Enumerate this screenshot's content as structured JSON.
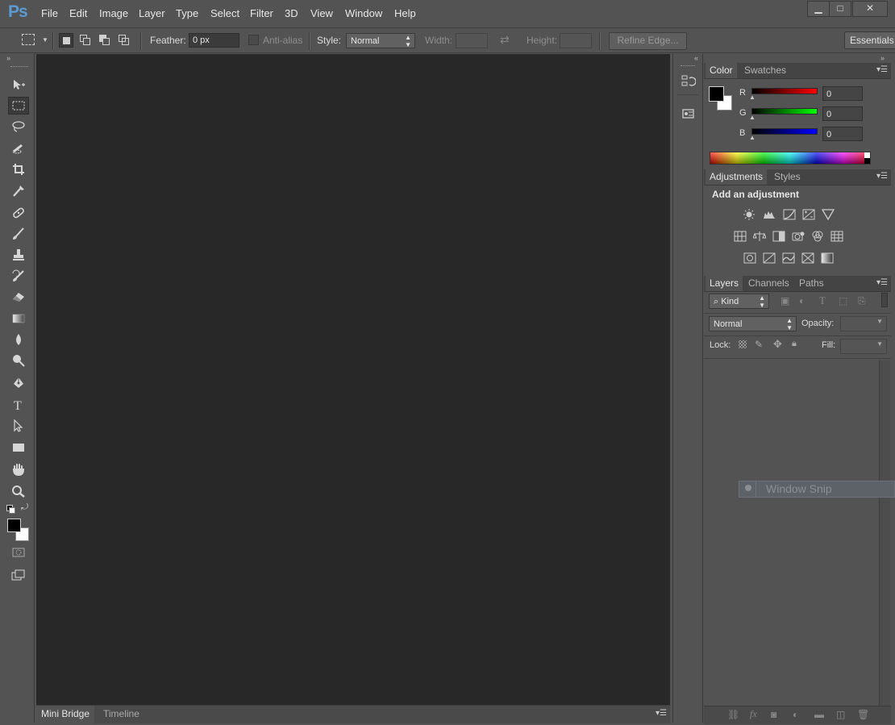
{
  "app": {
    "logo": "Ps"
  },
  "menu": [
    "File",
    "Edit",
    "Image",
    "Layer",
    "Type",
    "Select",
    "Filter",
    "3D",
    "View",
    "Window",
    "Help"
  ],
  "window_controls": {
    "minimize": "▁",
    "maximize": "□",
    "close": "✕"
  },
  "options": {
    "feather_label": "Feather:",
    "feather_value": "0 px",
    "antialias_label": "Anti-alias",
    "style_label": "Style:",
    "style_value": "Normal",
    "width_label": "Width:",
    "height_label": "Height:",
    "refine_label": "Refine Edge...",
    "workspace_label": "Essentials"
  },
  "bottom_tabs": [
    "Mini Bridge",
    "Timeline"
  ],
  "color_panel": {
    "tabs": [
      "Color",
      "Swatches"
    ],
    "r_label": "R",
    "g_label": "G",
    "b_label": "B",
    "r_value": "0",
    "g_value": "0",
    "b_value": "0"
  },
  "adjustments_panel": {
    "tabs": [
      "Adjustments",
      "Styles"
    ],
    "heading": "Add an adjustment"
  },
  "layers_panel": {
    "tabs": [
      "Layers",
      "Channels",
      "Paths"
    ],
    "filter_kind": "Kind",
    "blend_mode": "Normal",
    "opacity_label": "Opacity:",
    "lock_label": "Lock:",
    "fill_label": "Fill:"
  },
  "overlay": {
    "window_snip": "Window Snip"
  },
  "colors": {
    "chrome": "#535353",
    "canvas": "#282828",
    "foreground": "#000000",
    "background": "#ffffff",
    "logo": "#5b9bd5"
  }
}
